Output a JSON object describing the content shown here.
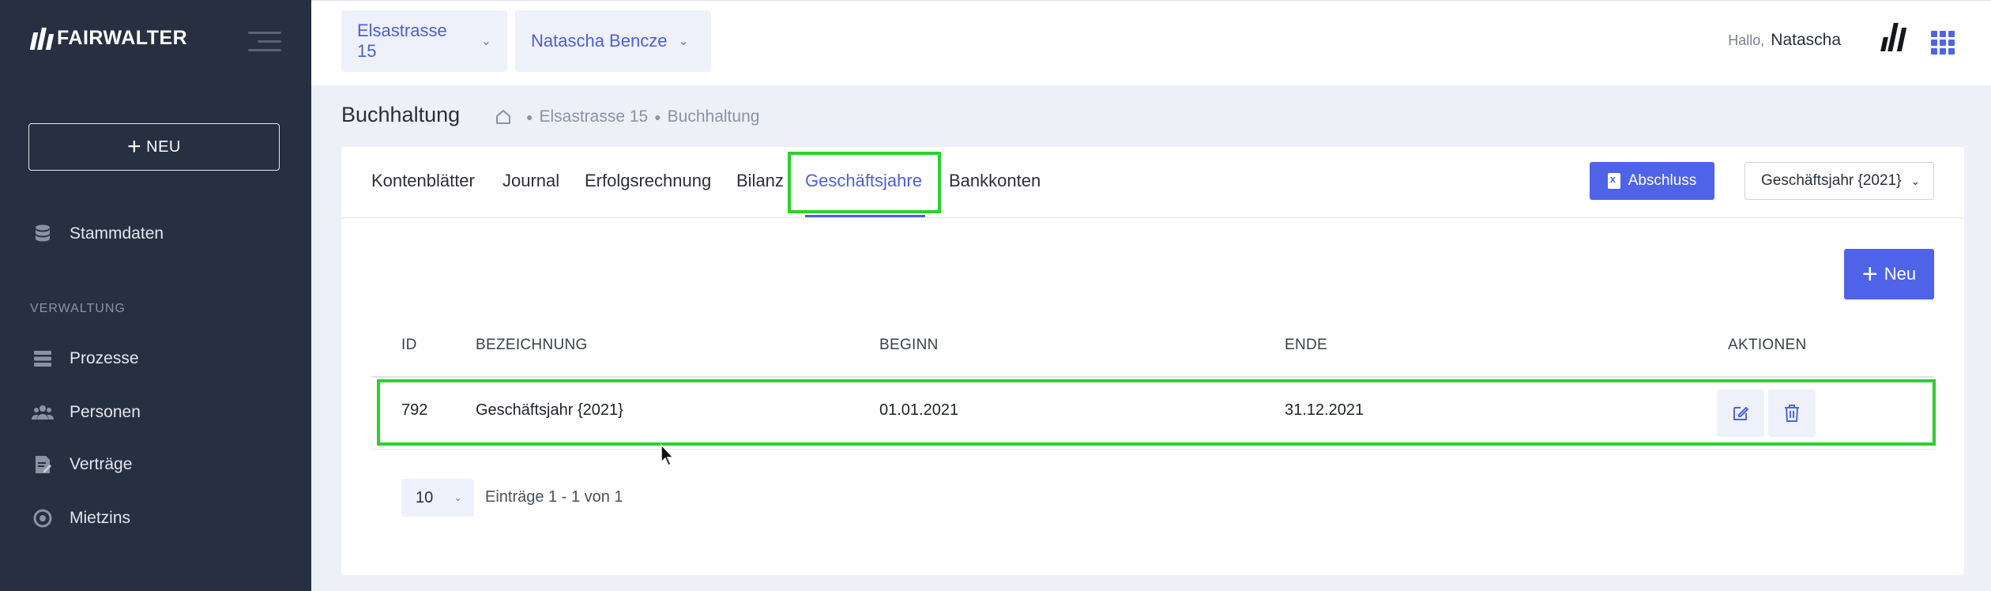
{
  "sidebar": {
    "logo_text": "FAIRWALTER",
    "new_button": "NEU",
    "items_top": [
      {
        "label": "Stammdaten",
        "icon": "database-icon"
      }
    ],
    "section_label": "VERWALTUNG",
    "items": [
      {
        "label": "Prozesse",
        "icon": "server-icon"
      },
      {
        "label": "Personen",
        "icon": "users-icon"
      },
      {
        "label": "Verträge",
        "icon": "contract-icon"
      },
      {
        "label": "Mietzins",
        "icon": "coins-icon"
      }
    ]
  },
  "header": {
    "property_select": "Elsastrasse 15",
    "person_select": "Natascha Bencze",
    "greeting": "Hallo,",
    "user_name": "Natascha"
  },
  "page": {
    "title": "Buchhaltung",
    "breadcrumb": [
      "Elsastrasse 15",
      "Buchhaltung"
    ]
  },
  "tabs": [
    {
      "label": "Kontenblätter"
    },
    {
      "label": "Journal"
    },
    {
      "label": "Erfolgsrechnung"
    },
    {
      "label": "Bilanz"
    },
    {
      "label": "Geschäftsjahre",
      "active": true
    },
    {
      "label": "Bankkonten"
    }
  ],
  "toolbar": {
    "abschluss_label": "Abschluss",
    "year_select": "Geschäftsjahr {2021}",
    "neu_label": "Neu"
  },
  "table": {
    "columns": [
      "ID",
      "BEZEICHNUNG",
      "BEGINN",
      "ENDE",
      "AKTIONEN"
    ],
    "rows": [
      {
        "id": "792",
        "bezeichnung": "Geschäftsjahr {2021}",
        "beginn": "01.01.2021",
        "ende": "31.12.2021"
      }
    ]
  },
  "pagination": {
    "page_size": "10",
    "entries_text": "Einträge 1 - 1 von 1"
  },
  "colors": {
    "sidebar_bg": "#263040",
    "accent": "#4f63e8",
    "highlight": "#2bd12b"
  }
}
